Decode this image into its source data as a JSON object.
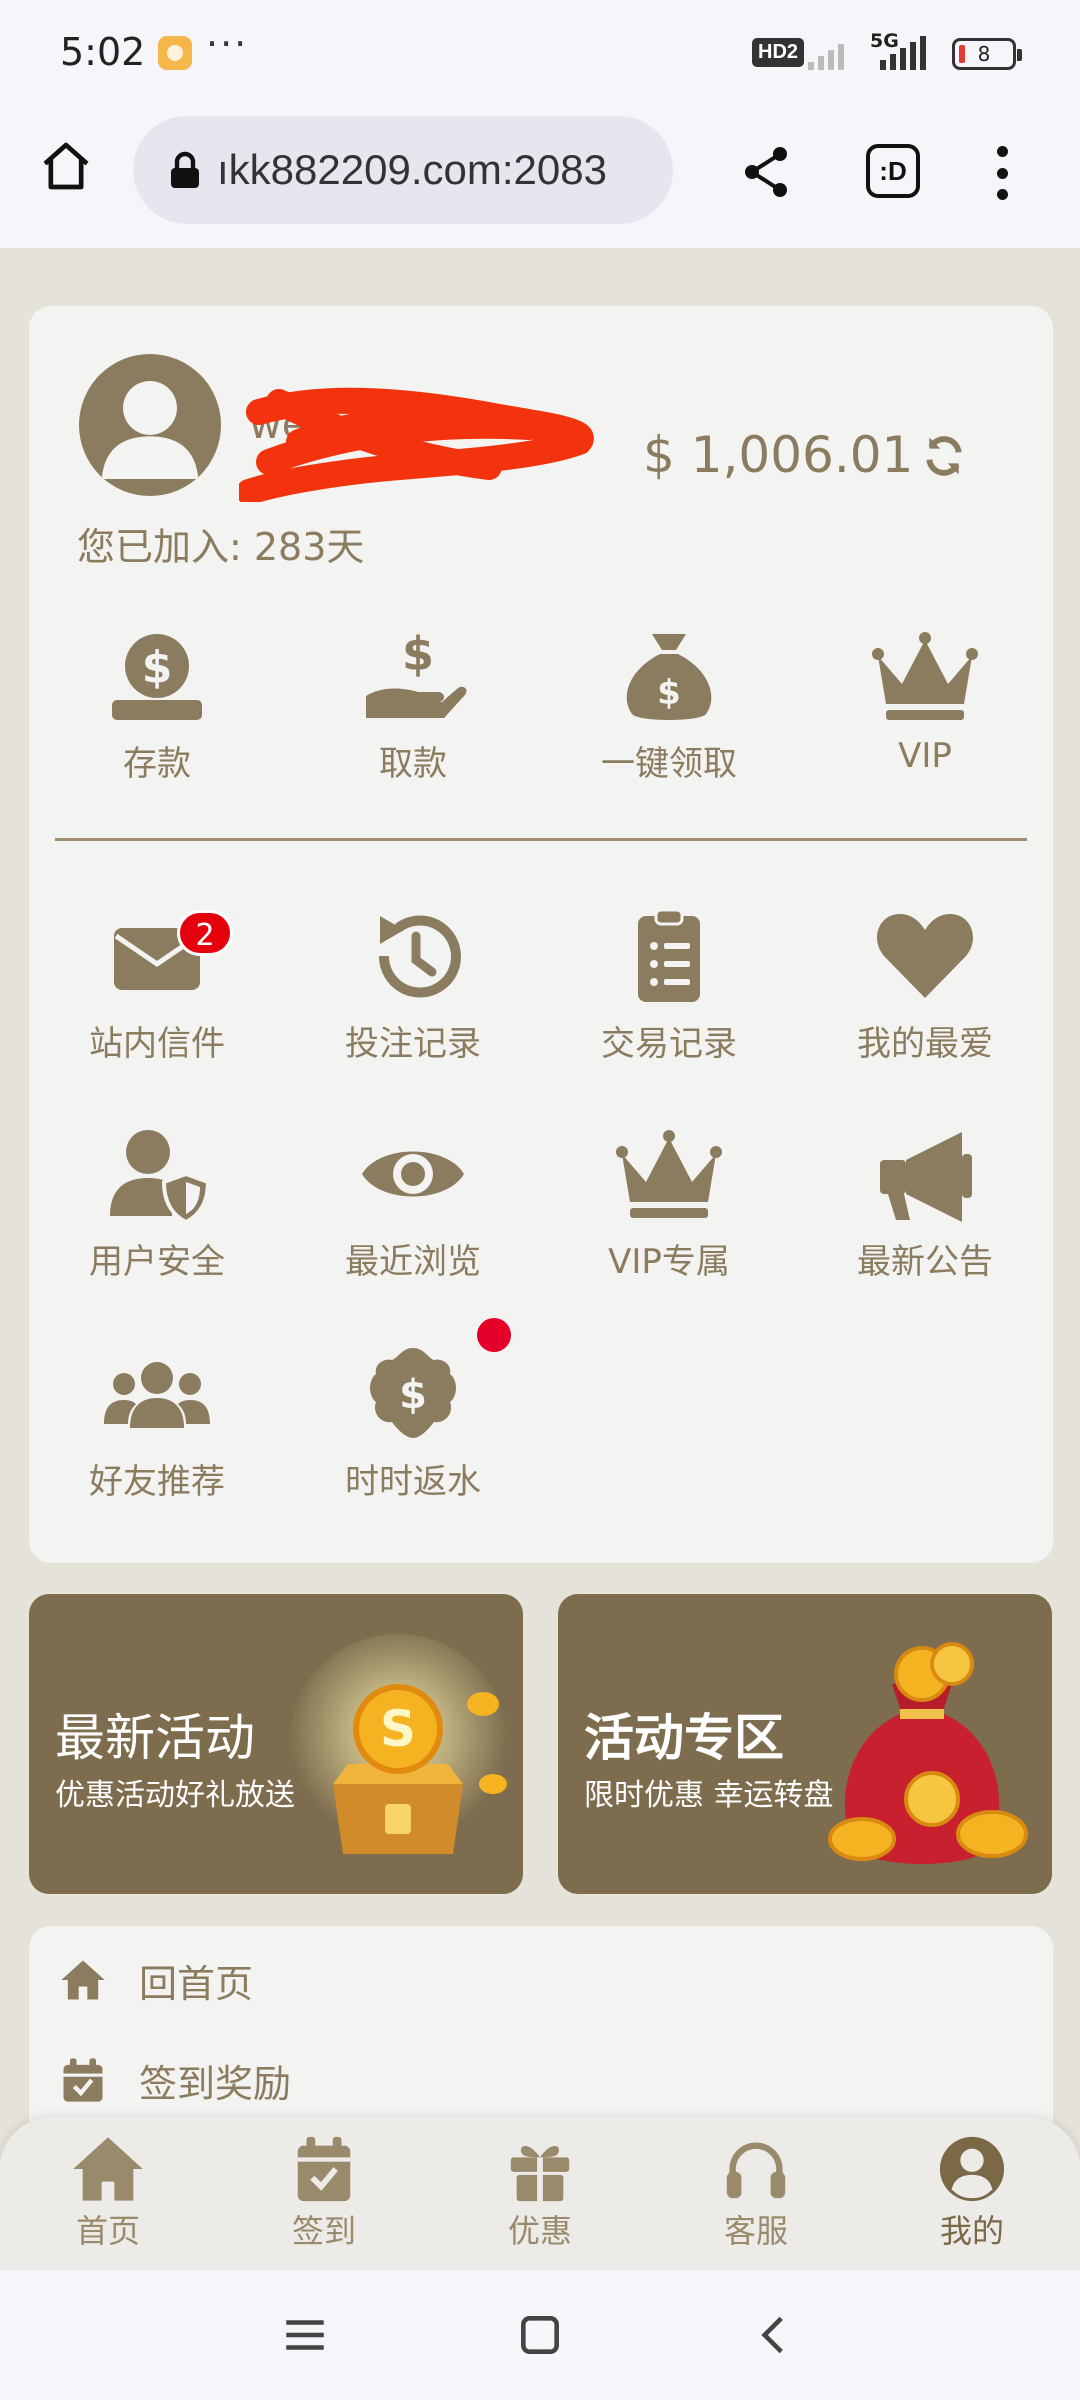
{
  "status_bar": {
    "time": "5:02",
    "more": "···",
    "hd_label": "HD2",
    "network": "5G",
    "battery": "8"
  },
  "browser": {
    "url": "ıkk882209.com:2083",
    "tab_count": ":D"
  },
  "profile": {
    "username": "we",
    "balance": "$ 1,006.01",
    "joined": "您已加入: 283天"
  },
  "quick_actions": [
    {
      "label": "存款",
      "icon": "deposit-icon"
    },
    {
      "label": "取款",
      "icon": "withdraw-icon"
    },
    {
      "label": "一键领取",
      "icon": "money-bag-icon"
    },
    {
      "label": "VIP",
      "icon": "crown-icon"
    }
  ],
  "menu_items": [
    {
      "label": "站内信件",
      "icon": "mail-icon",
      "badge": "2"
    },
    {
      "label": "投注记录",
      "icon": "history-icon"
    },
    {
      "label": "交易记录",
      "icon": "clipboard-list-icon"
    },
    {
      "label": "我的最爱",
      "icon": "heart-icon"
    },
    {
      "label": "用户安全",
      "icon": "user-shield-icon"
    },
    {
      "label": "最近浏览",
      "icon": "eye-icon"
    },
    {
      "label": "VIP专属",
      "icon": "crown-icon"
    },
    {
      "label": "最新公告",
      "icon": "megaphone-icon"
    },
    {
      "label": "好友推荐",
      "icon": "users-icon"
    },
    {
      "label": "时时返水",
      "icon": "dollar-badge-icon"
    }
  ],
  "promos": [
    {
      "title": "最新活动",
      "subtitle": "优惠活动好礼放送"
    },
    {
      "title": "活动专区",
      "subtitle": "限时优惠 幸运转盘"
    }
  ],
  "list": [
    {
      "label": "回首页",
      "icon": "home-icon"
    },
    {
      "label": "签到奖励",
      "icon": "calendar-check-icon"
    }
  ],
  "tabs": [
    {
      "label": "首页",
      "icon": "home-icon"
    },
    {
      "label": "签到",
      "icon": "calendar-check-icon"
    },
    {
      "label": "优惠",
      "icon": "gift-icon"
    },
    {
      "label": "客服",
      "icon": "headset-icon"
    },
    {
      "label": "我的",
      "icon": "user-circle-icon",
      "active": true
    }
  ],
  "colors": {
    "accent": "#8b7b5f",
    "banner": "#7d6c4e",
    "background": "#e5e2d9",
    "card": "#f3f3f1",
    "badge": "#e5000e"
  }
}
